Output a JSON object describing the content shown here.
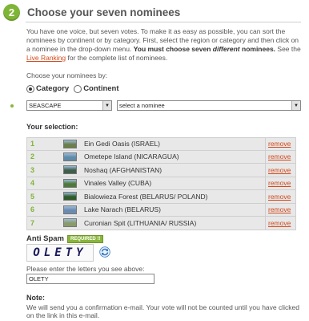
{
  "header": {
    "step_number": "2",
    "title": "Choose your seven nominees"
  },
  "intro": {
    "text_part1": "You have one voice, but seven votes. To make it as easy as possible, you can sort the nominees by continent or by category. First, select the region or category and then click on a nominee in the drop-down menu. ",
    "bold_part_a": "You must choose seven ",
    "bold_italic": "different",
    "bold_part_b": " nominees.",
    "see_text": " See the ",
    "link_text": "Live Ranking",
    "after_link": " for the complete list of nominees."
  },
  "choose_by": {
    "label": "Choose your nominees by:",
    "options": [
      {
        "label": "Category",
        "checked": true
      },
      {
        "label": "Continent",
        "checked": false
      }
    ]
  },
  "selects": {
    "region_value": "SEASCAPE",
    "nominee_value": "select a nominee"
  },
  "selection": {
    "heading": "Your selection:",
    "remove_label": "remove",
    "rows": [
      {
        "num": "1",
        "name": "Ein Gedi Oasis (ISRAEL)",
        "thumb_color": "#6a7f4a"
      },
      {
        "num": "2",
        "name": "Ometepe Island (NICARAGUA)",
        "thumb_color": "#5f8aa8"
      },
      {
        "num": "3",
        "name": "Noshaq (AFGHANISTAN)",
        "thumb_color": "#3f5f4a"
      },
      {
        "num": "4",
        "name": "Vinales Valley (CUBA)",
        "thumb_color": "#4f7a3a"
      },
      {
        "num": "5",
        "name": "Bialowieza Forest (BELARUS/ POLAND)",
        "thumb_color": "#2f5a2a"
      },
      {
        "num": "6",
        "name": "Lake Narach (BELARUS)",
        "thumb_color": "#6a8ab0"
      },
      {
        "num": "7",
        "name": "Curonian Spit (LITHUANIA/ RUSSIA)",
        "thumb_color": "#8a9a6a"
      }
    ]
  },
  "anti_spam": {
    "label": "Anti Spam",
    "badge": "REQUIRED !!",
    "captcha_text": "OLETY",
    "enter_label": "Please enter the letters you see above:",
    "input_value": "OLETY"
  },
  "note": {
    "title": "Note:",
    "text": "We will send you a confirmation e-mail. Your vote will not be counted until you have clicked on the link in this e-mail."
  }
}
